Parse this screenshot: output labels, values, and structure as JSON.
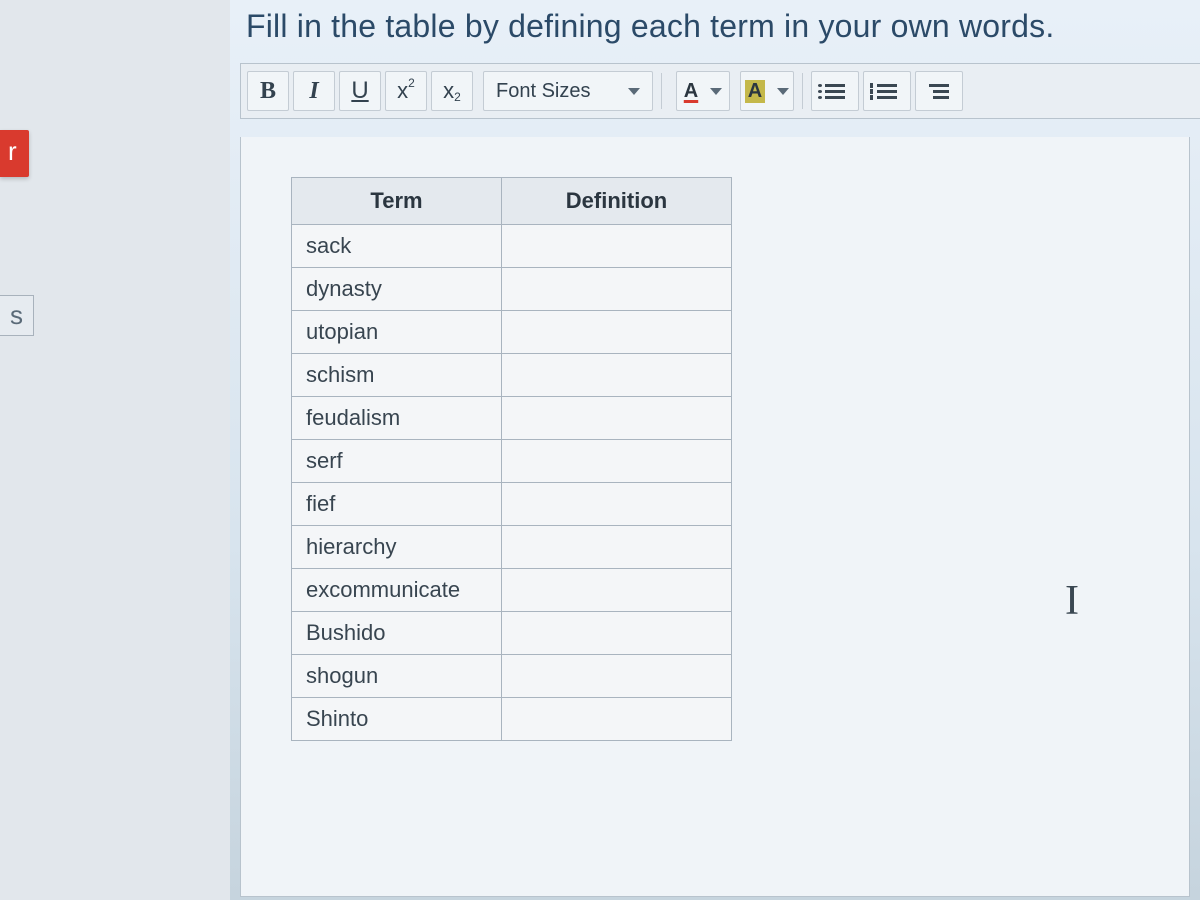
{
  "leftSidebar": {
    "redTabLetter": "r",
    "sTabLetter": "s"
  },
  "instruction": "Fill in the table by defining each term in your own words.",
  "toolbar": {
    "bold": "B",
    "italic": "I",
    "underline": "U",
    "superBase": "x",
    "superExp": "2",
    "subBase": "x",
    "subExp": "2",
    "fontSizesLabel": "Font Sizes",
    "textColorLetter": "A",
    "highlightLetter": "A"
  },
  "table": {
    "headers": {
      "term": "Term",
      "definition": "Definition"
    },
    "rows": [
      {
        "term": "sack",
        "definition": ""
      },
      {
        "term": "dynasty",
        "definition": ""
      },
      {
        "term": "utopian",
        "definition": ""
      },
      {
        "term": "schism",
        "definition": ""
      },
      {
        "term": "feudalism",
        "definition": ""
      },
      {
        "term": "serf",
        "definition": ""
      },
      {
        "term": "fief",
        "definition": ""
      },
      {
        "term": "hierarchy",
        "definition": ""
      },
      {
        "term": "excommunicate",
        "definition": ""
      },
      {
        "term": "Bushido",
        "definition": ""
      },
      {
        "term": "shogun",
        "definition": ""
      },
      {
        "term": "Shinto",
        "definition": ""
      }
    ]
  },
  "cursorGlyph": "I"
}
